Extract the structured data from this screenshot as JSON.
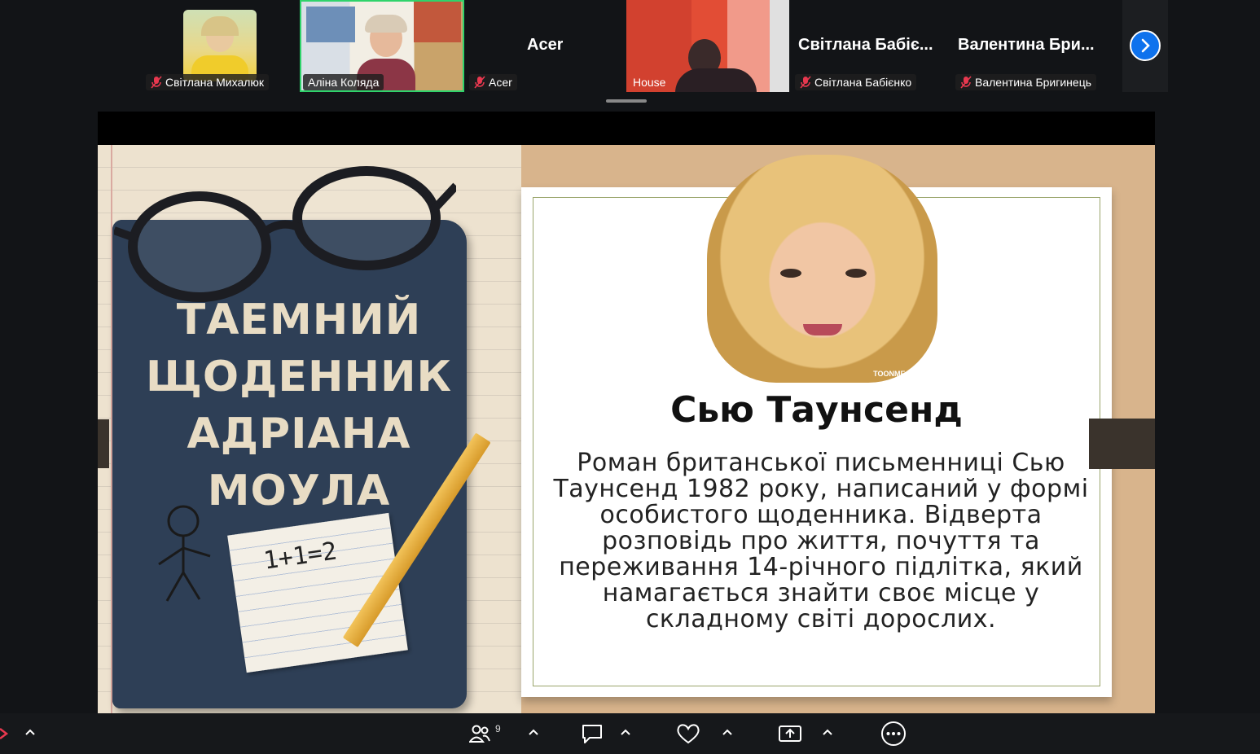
{
  "participants": [
    {
      "name": "Світлана Михалюк",
      "muted": true
    },
    {
      "name": "Аліна Коляда",
      "muted": false,
      "active_speaker": true
    },
    {
      "name": "Acer",
      "display": "Acer",
      "muted": true
    },
    {
      "name": "House",
      "muted": false
    },
    {
      "name": "Світлана Бабієнко",
      "display": "Світлана Бабіє...",
      "muted": true
    },
    {
      "name": "Валентина Бригинець",
      "display": "Валентина Бри...",
      "muted": true
    }
  ],
  "shared_slide": {
    "book_title": "ТАЕМНИЙ ЩОДЕННИК АДРІАНА МОУЛА",
    "note_formula": "1+1=2",
    "portrait_watermark": "TOONME.COM",
    "author": "Сью Таунсенд",
    "description": "Роман британської письменниці Сью Таунсенд 1982 року, написаний у формі особистого щоденника. Відверта розповідь про життя, почуття та переживання 14-річного підлітка, який намагається знайти своє місце у складному світі дорослих."
  },
  "toolbar": {
    "participants_count": "9",
    "icons": [
      "mic-icon",
      "participants-icon",
      "chat-icon",
      "reactions-icon",
      "share-screen-icon",
      "more-icon"
    ]
  },
  "colors": {
    "active_speaker_border": "#2fd36b",
    "next_button": "#0e72ed",
    "mute_icon": "#e8384f"
  }
}
